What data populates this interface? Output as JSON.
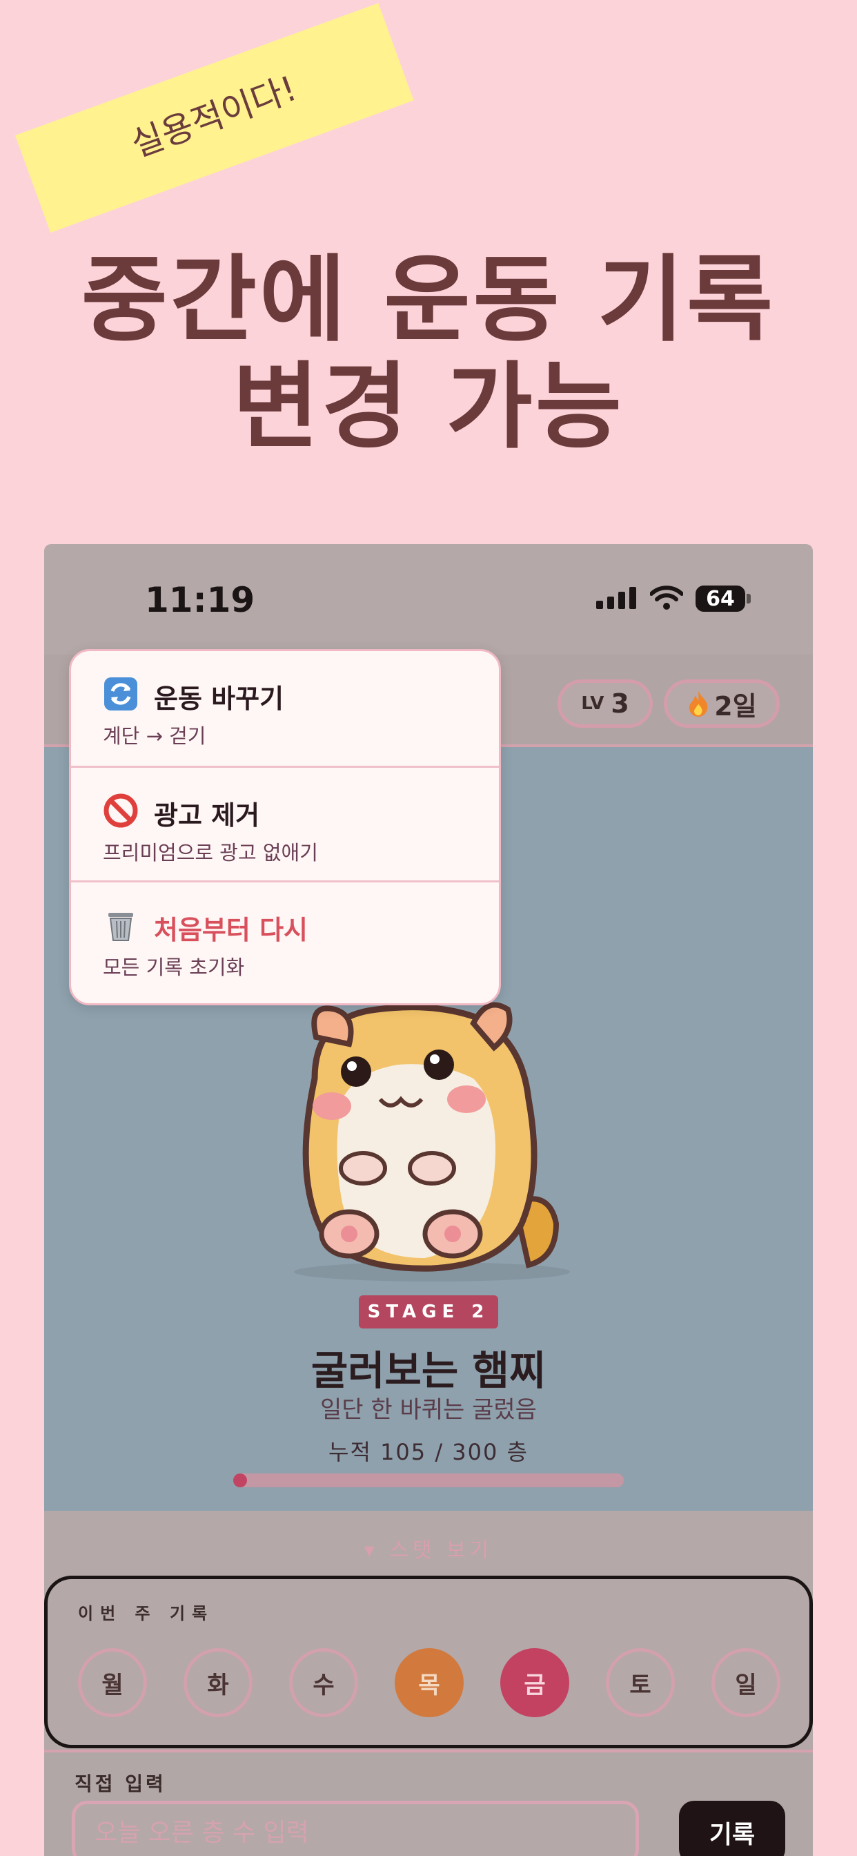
{
  "promo": {
    "tag": "실용적이다!",
    "headline_line1": "중간에 운동 기록",
    "headline_line2": "변경 가능"
  },
  "status_bar": {
    "time": "11:19",
    "battery": "64"
  },
  "header": {
    "level_prefix": "LV",
    "level_value": "3",
    "streak_icon": "fire-icon",
    "streak_value": "2일"
  },
  "menu": {
    "items": [
      {
        "icon": "refresh-icon",
        "title": "운동 바꾸기",
        "subtitle": "계단 → 걷기"
      },
      {
        "icon": "prohibited-icon",
        "title": "광고 제거",
        "subtitle": "프리미엄으로 광고 없애기"
      },
      {
        "icon": "trash-icon",
        "title": "처음부터 다시",
        "subtitle": "모든 기록 초기화",
        "color": "#d9505d"
      }
    ]
  },
  "character": {
    "stage": "STAGE 2",
    "name": "굴러보는 햄찌",
    "subtitle": "일단 한 바퀴는 굴렀음",
    "total_label": "누적 105 / 300 층",
    "progress": 0.02
  },
  "stats_toggle": "▾ 스탯 보기",
  "week": {
    "title": "이번 주 기록",
    "days": [
      "월",
      "화",
      "수",
      "목",
      "금",
      "토",
      "일"
    ],
    "highlight_colors": {
      "목": "#d27a3e",
      "금": "#c44261"
    }
  },
  "direct_input": {
    "label": "직접 입력",
    "placeholder": "오늘 오른 층 수 입력",
    "button": "기록"
  },
  "colors": {
    "background": "#fdd3da",
    "headline": "#6b3a3a",
    "tag": "#fff28f",
    "accent": "#c14563"
  }
}
